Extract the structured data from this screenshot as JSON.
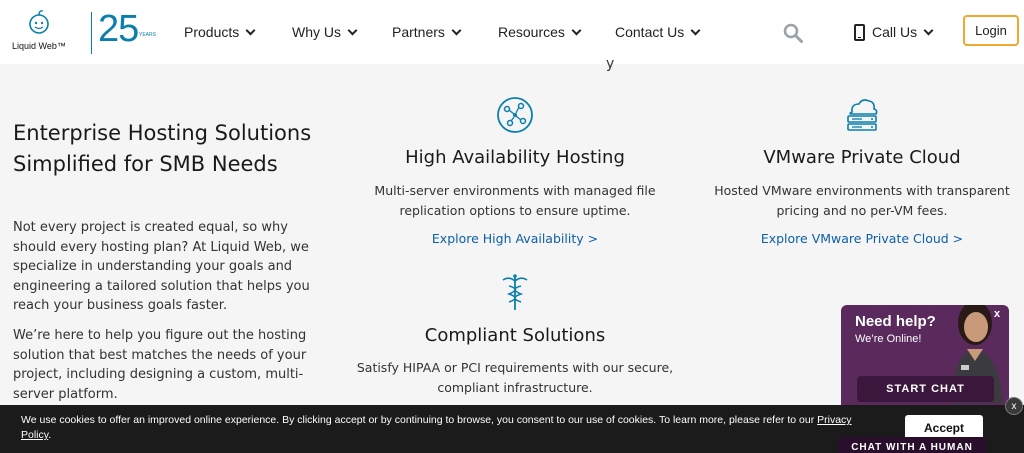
{
  "header": {
    "logo_text": "Liquid Web™",
    "anniversary": "25",
    "anniversary_sub": "YEARS",
    "nav": [
      "Products",
      "Why Us",
      "Partners",
      "Resources",
      "Contact Us"
    ],
    "call_label": "Call Us",
    "login_label": "Login"
  },
  "top_cutoff": "y",
  "hero": {
    "title": "Enterprise Hosting Solutions Simplified for SMB Needs",
    "paragraph1": "Not every project is created equal, so why should every hosting plan? At Liquid Web, we specialize in understanding your goals and engineering a tailored solution that helps you reach your business goals faster.",
    "paragraph2": "We’re here to help you figure out the hosting solution that best matches the needs of your project, including designing a custom, multi-server platform."
  },
  "cards": {
    "ha": {
      "title": "High Availability Hosting",
      "desc": "Multi-server environments with managed file replication options to ensure uptime.",
      "link": "Explore High Availability >",
      "icon": "network-globe-icon"
    },
    "vmware": {
      "title": "VMware Private Cloud",
      "desc": "Hosted VMware environments with transparent pricing and no per-VM fees.",
      "link": "Explore VMware Private Cloud >",
      "icon": "cloud-server-icon"
    },
    "compliant": {
      "title": "Compliant Solutions",
      "desc": "Satisfy HIPAA or PCI requirements with our secure, compliant infrastructure.",
      "icon": "caduceus-icon"
    }
  },
  "chat": {
    "need_help": "Need help?",
    "online": "We’re Online!",
    "close": "x",
    "start": "START CHAT",
    "human": "CHAT WITH A HUMAN"
  },
  "cookie": {
    "message": "We use cookies to offer an improved online experience. By clicking accept or by continuing to browse, you consent to our use of cookies. To learn more, please refer to our",
    "link": "Privacy Policy",
    "period": ".",
    "accept": "Accept",
    "close": "x"
  },
  "colors": {
    "accent": "#0b7fab",
    "link": "#0b5fa8",
    "login_border": "#f0a830",
    "chat_bg": "#5a2a5c",
    "cookie_bg": "#1b1b1b"
  }
}
